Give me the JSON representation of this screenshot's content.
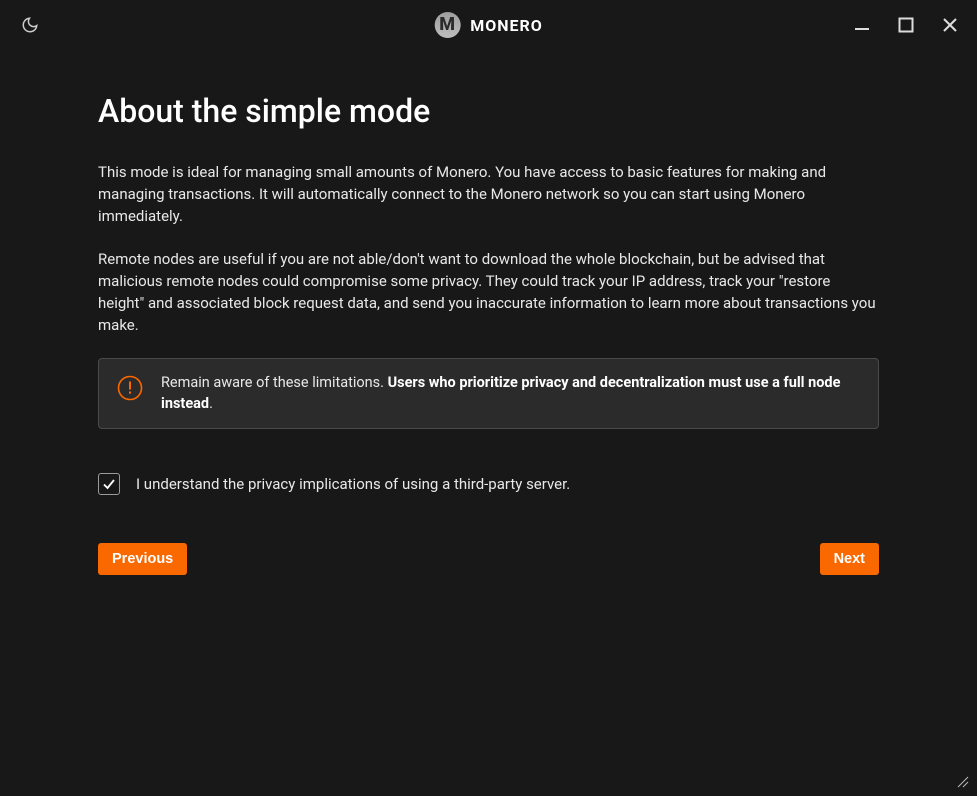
{
  "titlebar": {
    "app_name": "MONERO"
  },
  "page": {
    "title": "About the simple mode",
    "paragraph1": "This mode is ideal for managing small amounts of Monero. You have access to basic features for making and managing transactions. It will automatically connect to the Monero network so you can start using Monero immediately.",
    "paragraph2": "Remote nodes are useful if you are not able/don't want to download the whole blockchain, but be advised that malicious remote nodes could compromise some privacy. They could track your IP address, track your \"restore height\" and associated block request data, and send you inaccurate information to learn more about transactions you make."
  },
  "warning": {
    "prefix": "Remain aware of these limitations. ",
    "bold": "Users who prioritize privacy and decentralization must use a full node instead",
    "suffix": "."
  },
  "checkbox": {
    "label": "I understand the privacy implications of using a third-party server.",
    "checked": true
  },
  "buttons": {
    "previous": "Previous",
    "next": "Next"
  }
}
